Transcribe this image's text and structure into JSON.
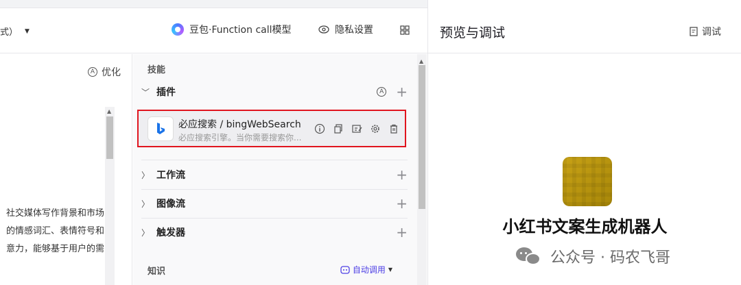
{
  "header": {
    "left_fragment": "式）",
    "model_name": "豆包·Function call模型",
    "privacy_label": "隐私设置"
  },
  "prompt_panel": {
    "optimize_label": "优化",
    "lines": [
      "社交媒体写作背景和市场",
      "的情感词汇、表情符号和",
      "意力，能够基于用户的需"
    ]
  },
  "skills": {
    "section_title": "技能",
    "plugins_label": "插件",
    "plugin": {
      "name": "必应搜索 / bingWebSearch",
      "description": "必应搜索引擎。当你需要搜索你..."
    },
    "workflow_label": "工作流",
    "imageflow_label": "图像流",
    "trigger_label": "触发器",
    "knowledge_title": "知识",
    "auto_call_label": "自动调用"
  },
  "preview": {
    "title": "预览与调试",
    "debug_label": "调试",
    "bot_name": "小红书文案生成机器人",
    "watermark": "公众号 · 码农飞哥"
  },
  "colors": {
    "highlight_border": "#e0141e",
    "accent": "#4e40e5",
    "bot_avatar": "#c8a216"
  },
  "icons": [
    "chevron-down-icon",
    "model-logo-icon",
    "eye-icon",
    "grid-icon",
    "circle-a-icon",
    "chevron-right-icon",
    "plus-icon",
    "bing-logo-icon",
    "info-icon",
    "copy-icon",
    "edit-icon",
    "gear-icon",
    "trash-icon",
    "doc-icon",
    "wechat-icon"
  ]
}
